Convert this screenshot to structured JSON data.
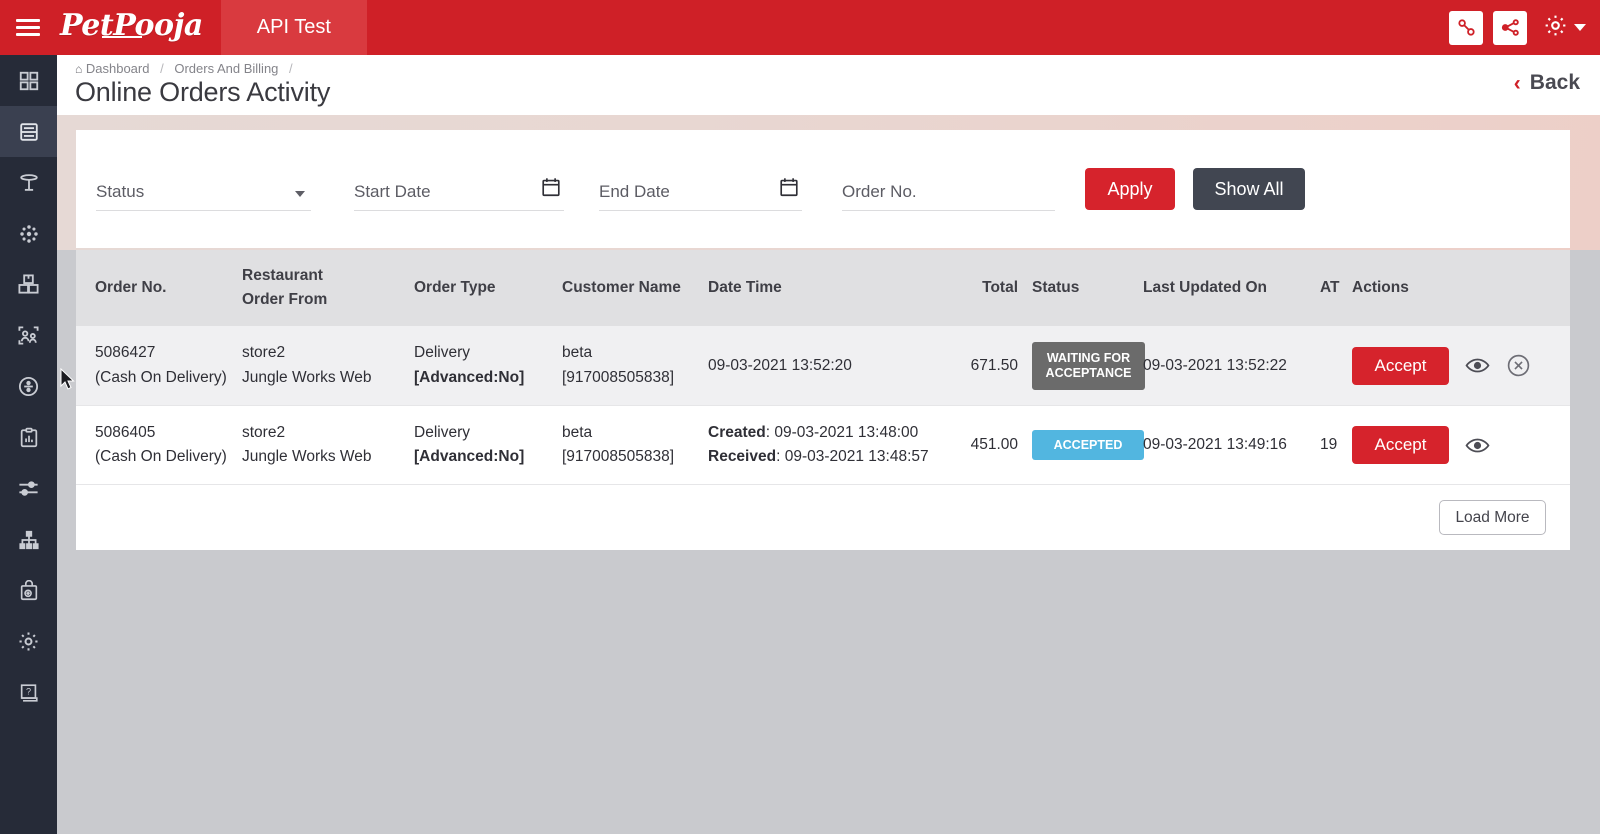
{
  "topbar": {
    "menu_icon": "hamburger-icon",
    "brand": "PetPooja",
    "app_tab": "API Test",
    "link_icon": "link-chain-icon",
    "share_icon": "share-network-icon",
    "gear_icon": "gear-icon",
    "caret_icon": "chevron-down-icon",
    "bg_color": "#cf2027"
  },
  "sidebar": {
    "items": [
      {
        "name": "dashboard-grid",
        "icon": "grid-icon",
        "active": false
      },
      {
        "name": "orders-billing",
        "icon": "list-card-icon",
        "active": true
      },
      {
        "name": "table-management",
        "icon": "table-icon",
        "active": false
      },
      {
        "name": "items",
        "icon": "asterisk-dot-icon",
        "active": false
      },
      {
        "name": "inventory",
        "icon": "boxes-icon",
        "active": false
      },
      {
        "name": "customers",
        "icon": "users-frame-icon",
        "active": false
      },
      {
        "name": "payments",
        "icon": "rupee-circle-icon",
        "active": false
      },
      {
        "name": "reports",
        "icon": "clipboard-chart-icon",
        "active": false
      },
      {
        "name": "configuration",
        "icon": "sliders-icon",
        "active": false
      },
      {
        "name": "hierarchy",
        "icon": "org-tree-icon",
        "active": false
      },
      {
        "name": "online-store",
        "icon": "shopping-bag-icon",
        "active": false
      },
      {
        "name": "settings",
        "icon": "gear-icon",
        "active": false
      },
      {
        "name": "help",
        "icon": "help-book-icon",
        "active": false
      }
    ]
  },
  "breadcrumb": {
    "home_icon": "home-icon",
    "items": [
      "Dashboard",
      "Orders And Billing"
    ],
    "separator": "/"
  },
  "page": {
    "title": "Online Orders Activity",
    "back_label": "Back",
    "back_icon": "chevron-left-icon"
  },
  "filters": {
    "status": {
      "label": "Status",
      "value": "",
      "caret": "chevron-down-icon"
    },
    "start_date": {
      "label": "Start Date",
      "value": "",
      "icon": "calendar-icon"
    },
    "end_date": {
      "label": "End Date",
      "value": "",
      "icon": "calendar-icon"
    },
    "order_no": {
      "label": "Order No.",
      "value": ""
    },
    "apply_label": "Apply",
    "show_all_label": "Show All",
    "apply_color": "#d6232c",
    "show_all_color": "#414651"
  },
  "table": {
    "headers": {
      "order_no": "Order No.",
      "restaurant_order_from_l1": "Restaurant",
      "restaurant_order_from_l2": "Order From",
      "order_type": "Order Type",
      "customer_name": "Customer Name",
      "date_time": "Date Time",
      "total": "Total",
      "status": "Status",
      "last_updated_on": "Last Updated On",
      "at": "AT",
      "actions": "Actions"
    },
    "rows": [
      {
        "order_no": "5086427",
        "payment_mode": "(Cash On Delivery)",
        "restaurant": "store2",
        "order_from": "Jungle Works Web",
        "order_type": "Delivery",
        "advanced": "[Advanced:No]",
        "customer_name": "beta",
        "customer_phone": "[917008505838]",
        "date_time_single": "09-03-2021 13:52:20",
        "created_label": "",
        "created_value": "",
        "received_label": "",
        "received_value": "",
        "total": "671.50",
        "status": "WAITING FOR ACCEPTANCE",
        "status_color": "#6b6b6b",
        "last_updated_on": "09-03-2021 13:52:22",
        "at": "",
        "accept_label": "Accept",
        "view_icon": "eye-icon",
        "cancel_icon": "circle-x-icon",
        "has_cancel": true
      },
      {
        "order_no": "5086405",
        "payment_mode": "(Cash On Delivery)",
        "restaurant": "store2",
        "order_from": "Jungle Works Web",
        "order_type": "Delivery",
        "advanced": "[Advanced:No]",
        "customer_name": "beta",
        "customer_phone": "[917008505838]",
        "date_time_single": "",
        "created_label": "Created",
        "created_value": "09-03-2021 13:48:00",
        "received_label": "Received",
        "received_value": "09-03-2021 13:48:57",
        "total": "451.00",
        "status": "ACCEPTED",
        "status_color": "#52b6e0",
        "last_updated_on": "09-03-2021 13:49:16",
        "at": "19",
        "accept_label": "Accept",
        "view_icon": "eye-icon",
        "cancel_icon": "",
        "has_cancel": false
      }
    ],
    "load_more_label": "Load More"
  }
}
